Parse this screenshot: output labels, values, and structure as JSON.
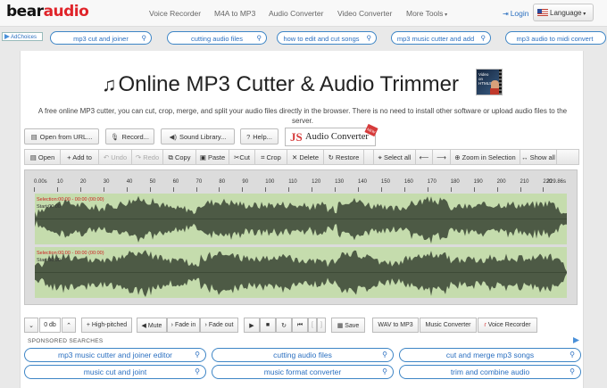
{
  "nav": {
    "logo_part1": "bear",
    "logo_part2": "audio",
    "links": [
      "Voice Recorder",
      "M4A to MP3",
      "Audio Converter",
      "Video Converter",
      "More Tools"
    ],
    "login": "Login",
    "language": "Language"
  },
  "ad_row": {
    "adchoices": "AdChoices",
    "keywords": [
      "mp3 cut and joiner",
      "cutting audio files",
      "how to edit and cut songs",
      "mp3 music cutter and add",
      "mp3 audio to midi convert"
    ]
  },
  "page": {
    "title": "Online MP3 Cutter & Audio Trimmer",
    "thumb_text": "Video on HTML5",
    "description": "A free online MP3 cutter, you can cut, crop, merge, and split your audio files directly in the browser. There is no need to install other software or upload audio files to the server."
  },
  "source_buttons": {
    "open_url": "Open from URL...",
    "record": "Record...",
    "sound_library": "Sound Library...",
    "help": "Help...",
    "js_prefix": "JS",
    "js_name": "Audio Converter",
    "js_badge": "NEW"
  },
  "toolbar": {
    "open": "Open",
    "add_to": "Add to",
    "undo": "Undo",
    "redo": "Redo",
    "copy": "Copy",
    "paste": "Paste",
    "cut": "Cut",
    "crop": "Crop",
    "delete": "Delete",
    "restore": "Restore",
    "select_all": "Select all",
    "zoom": "Zoom in Selection",
    "show_all": "Show all"
  },
  "ruler": {
    "ticks": [
      "0.00s",
      "10",
      "20",
      "30",
      "40",
      "50",
      "60",
      "70",
      "80",
      "90",
      "100",
      "110",
      "120",
      "130",
      "140",
      "150",
      "160",
      "170",
      "180",
      "190",
      "200",
      "210",
      "220"
    ],
    "end_label": "229.86s"
  },
  "tracks": [
    {
      "selection": "Selection:00:00 - 00:00 (00:00)",
      "start": "Start:00:00"
    },
    {
      "selection": "Selection:00:00 - 00:00 (00:00)",
      "start": "Start:00:00"
    }
  ],
  "transport": {
    "volume_down": "⌄",
    "gain": "0 db",
    "volume_up": "⌃",
    "high_pitched": "High-pitched",
    "mute": "Mute",
    "fade_in": "Fade in",
    "fade_out": "Fade out",
    "save": "Save",
    "wav_to_mp3": "WAV to MP3",
    "music_converter": "Music Converter",
    "voice_recorder": "Voice Recorder"
  },
  "sponsored": {
    "label": "SPONSORED SEARCHES",
    "ads": [
      "mp3 music cutter and joiner editor",
      "cutting audio files",
      "cut and merge mp3 songs",
      "music cut and joint",
      "music format converter",
      "trim and combine audio"
    ]
  },
  "colors": {
    "accent_red": "#e0242a",
    "link_blue": "#2a6fc0",
    "wave_bg": "#c5dcad",
    "wave_fg": "#4d5a45"
  }
}
